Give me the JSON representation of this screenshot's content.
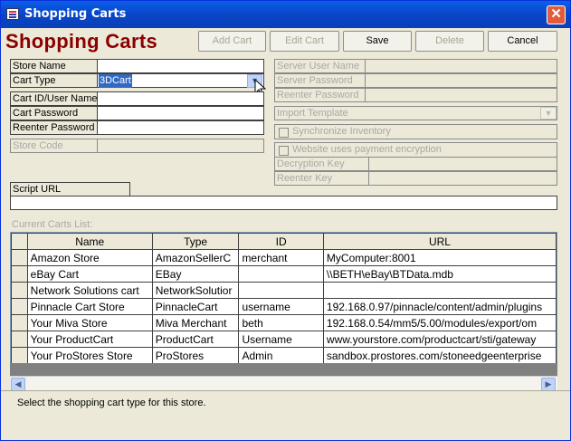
{
  "window": {
    "title": "Shopping Carts",
    "close_glyph": "✕"
  },
  "header": {
    "title": "Shopping Carts"
  },
  "toolbar": {
    "add": "Add Cart",
    "edit": "Edit Cart",
    "save": "Save",
    "delete": "Delete",
    "cancel": "Cancel"
  },
  "form": {
    "store_name_label": "Store Name",
    "cart_type_label": "Cart Type",
    "cart_type_value": "3DCart",
    "cart_id_label": "Cart ID/User Name",
    "cart_password_label": "Cart Password",
    "reenter_password_label": "Reenter Password",
    "store_code_label": "Store Code",
    "server_user_label": "Server User Name",
    "server_password_label": "Server Password",
    "server_reenter_label": "Reenter Password",
    "import_template_label": "Import Template",
    "sync_inventory_label": "Synchronize Inventory",
    "encryption_label": "Website uses payment encryption",
    "decryption_key_label": "Decryption Key",
    "reenter_key_label": "Reenter Key",
    "script_url_label": "Script URL"
  },
  "list": {
    "caption": "Current Carts List:",
    "columns": [
      "Name",
      "Type",
      "ID",
      "URL"
    ],
    "rows": [
      [
        "Amazon Store",
        "AmazonSellerC",
        "merchant",
        "MyComputer:8001"
      ],
      [
        "eBay Cart",
        "EBay",
        "",
        "\\\\BETH\\eBay\\BTData.mdb"
      ],
      [
        "Network Solutions cart",
        "NetworkSolutior",
        "",
        ""
      ],
      [
        "Pinnacle Cart Store",
        "PinnacleCart",
        "username",
        "192.168.0.97/pinnacle/content/admin/plugins"
      ],
      [
        "Your Miva Store",
        "Miva Merchant",
        "beth",
        "192.168.0.54/mm5/5.00/modules/export/om"
      ],
      [
        "Your ProductCart",
        "ProductCart",
        "Username",
        "www.yourstore.com/productcart/sti/gateway"
      ],
      [
        "Your ProStores Store",
        "ProStores",
        "Admin",
        "sandbox.prostores.com/stoneedgeenterprise"
      ]
    ]
  },
  "status": {
    "text": "Select the shopping cart type for this store."
  }
}
